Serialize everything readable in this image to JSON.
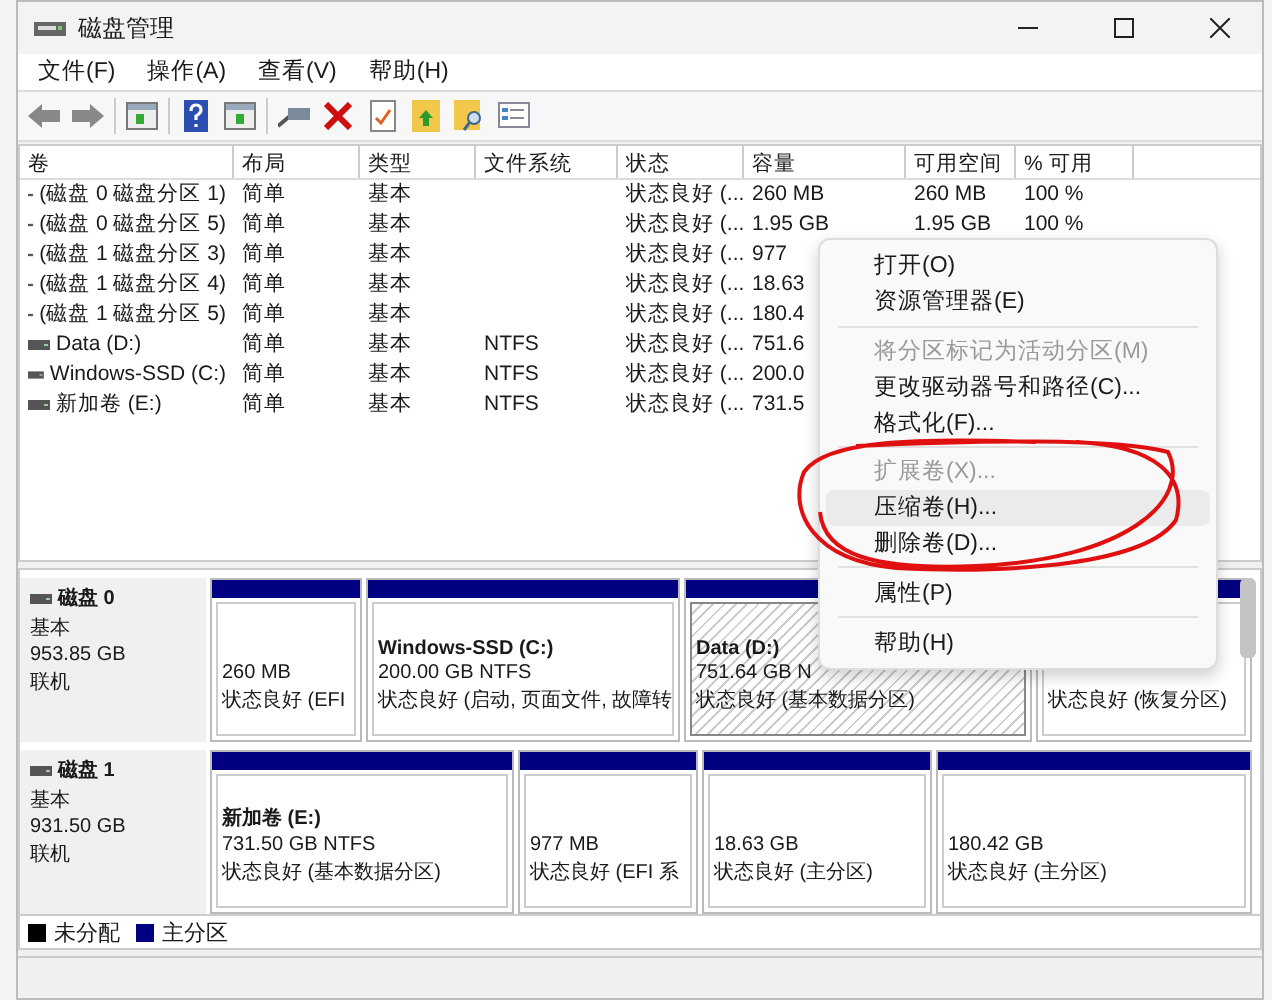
{
  "window": {
    "title": "磁盘管理"
  },
  "menu_bar": [
    "文件(F)",
    "操作(A)",
    "查看(V)",
    "帮助(H)"
  ],
  "volume_table": {
    "columns": [
      "卷",
      "布局",
      "类型",
      "文件系统",
      "状态",
      "容量",
      "可用空间",
      "% 可用"
    ],
    "rows": [
      {
        "volume": "(磁盘 0 磁盘分区 1)",
        "layout": "简单",
        "type": "基本",
        "status": "状态良好 (...",
        "capacity": "260 MB",
        "free_space": "260 MB",
        "percent_free": "100 %"
      },
      {
        "volume": "(磁盘 0 磁盘分区 5)",
        "layout": "简单",
        "type": "基本",
        "status": "状态良好 (...",
        "capacity": "1.95 GB",
        "free_space": "1.95 GB",
        "percent_free": "100 %"
      },
      {
        "volume": "(磁盘 1 磁盘分区 3)",
        "layout": "简单",
        "type": "基本",
        "status": "状态良好 (...",
        "capacity": "977"
      },
      {
        "volume": "(磁盘 1 磁盘分区 4)",
        "layout": "简单",
        "type": "基本",
        "status": "状态良好 (...",
        "capacity": "18.63"
      },
      {
        "volume": "(磁盘 1 磁盘分区 5)",
        "layout": "简单",
        "type": "基本",
        "status": "状态良好 (...",
        "capacity": "180.4"
      },
      {
        "volume": "Data (D:)",
        "layout": "简单",
        "type": "基本",
        "file_system": "NTFS",
        "status": "状态良好 (...",
        "capacity": "751.6"
      },
      {
        "volume": "Windows-SSD (C:)",
        "layout": "简单",
        "type": "基本",
        "file_system": "NTFS",
        "status": "状态良好 (...",
        "capacity": "200.0"
      },
      {
        "volume": "新加卷 (E:)",
        "layout": "简单",
        "type": "基本",
        "file_system": "NTFS",
        "status": "状态良好 (...",
        "capacity": "731.5"
      }
    ]
  },
  "disks": [
    {
      "name": "磁盘 0",
      "type": "基本",
      "size": "953.85 GB",
      "status": "联机",
      "partitions": [
        {
          "size_line": "260 MB",
          "status_line": "状态良好 (EFI",
          "selected": false
        },
        {
          "title": "Windows-SSD (C:)",
          "size_line": "200.00 GB NTFS",
          "status_line": "状态良好 (启动, 页面文件, 故障转",
          "selected": false
        },
        {
          "title": "Data (D:)",
          "size_line": "751.64 GB N",
          "status_line": "状态良好 (基本数据分区)",
          "selected": true
        },
        {
          "status_line": "状态良好 (恢复分区)",
          "selected": false
        }
      ]
    },
    {
      "name": "磁盘 1",
      "type": "基本",
      "size": "931.50 GB",
      "status": "联机",
      "partitions": [
        {
          "title": "新加卷 (E:)",
          "size_line": "731.50 GB NTFS",
          "status_line": "状态良好 (基本数据分区)",
          "selected": false
        },
        {
          "size_line": "977 MB",
          "status_line": "状态良好 (EFI 系",
          "selected": false
        },
        {
          "size_line": "18.63 GB",
          "status_line": "状态良好 (主分区)",
          "selected": false
        },
        {
          "size_line": "180.42 GB",
          "status_line": "状态良好 (主分区)",
          "selected": false
        }
      ]
    }
  ],
  "legend": [
    {
      "label": "未分配",
      "color": "#000000"
    },
    {
      "label": "主分区",
      "color": "#000080"
    }
  ],
  "context_menu": {
    "items": [
      {
        "kind": "item",
        "label": "打开(O)",
        "disabled": false,
        "selected": false
      },
      {
        "kind": "item",
        "label": "资源管理器(E)",
        "disabled": false,
        "selected": false
      },
      {
        "kind": "separator"
      },
      {
        "kind": "item",
        "label": "将分区标记为活动分区(M)",
        "disabled": true,
        "selected": false
      },
      {
        "kind": "item",
        "label": "更改驱动器号和路径(C)...",
        "disabled": false,
        "selected": false
      },
      {
        "kind": "item",
        "label": "格式化(F)...",
        "disabled": false,
        "selected": false
      },
      {
        "kind": "separator"
      },
      {
        "kind": "item",
        "label": "扩展卷(X)...",
        "disabled": true,
        "selected": false
      },
      {
        "kind": "item",
        "label": "压缩卷(H)...",
        "disabled": false,
        "selected": true
      },
      {
        "kind": "item",
        "label": "删除卷(D)...",
        "disabled": false,
        "selected": false
      },
      {
        "kind": "separator"
      },
      {
        "kind": "item",
        "label": "属性(P)",
        "disabled": false,
        "selected": false
      },
      {
        "kind": "separator"
      },
      {
        "kind": "item",
        "label": "帮助(H)",
        "disabled": false,
        "selected": false
      }
    ]
  }
}
